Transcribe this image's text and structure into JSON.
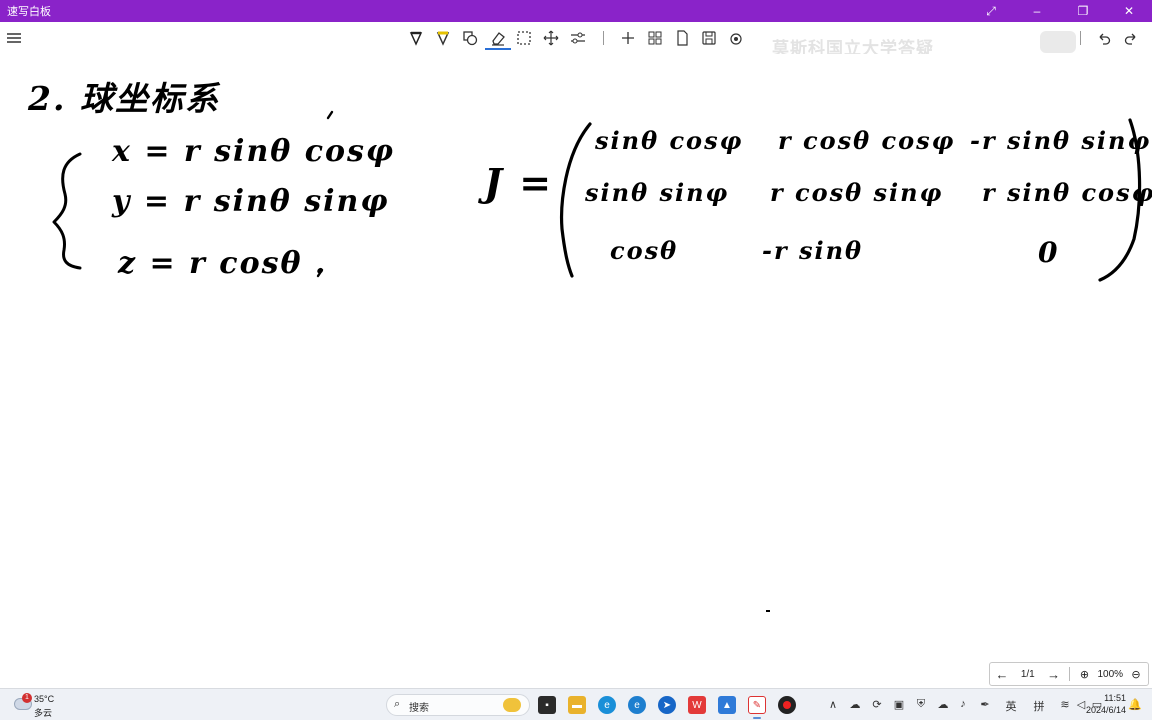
{
  "window": {
    "title": "速写白板"
  },
  "watermark": {
    "text": "莫斯科国立大学答疑"
  },
  "toolbar": {
    "accent_color": "#2a6fd6",
    "titlebar_color": "#8a23c9"
  },
  "ink": {
    "heading": "2. 球坐标系",
    "equations": [
      "x = r sinθ cosφ",
      "y = r sinθ sinφ",
      "z = r cosθ ."
    ],
    "jacobian_label": "J =",
    "matrix": [
      [
        "sinθ cosφ",
        "r cosθ cosφ",
        "-r sinθ sinφ"
      ],
      [
        "sinθ sinφ",
        "r cosθ sinφ",
        "r sinθ cosφ"
      ],
      [
        "cosθ",
        "-r sinθ",
        "0"
      ]
    ]
  },
  "pagenav": {
    "prev": "←",
    "page": "1/1",
    "next": "→",
    "zoom": "100%"
  },
  "taskbar": {
    "weather_temp": "35°C",
    "weather_cond": "多云",
    "weather_badge": "1",
    "search_placeholder": "搜索",
    "ime_lang": "英",
    "ime_mode": "拼",
    "time": "11:51",
    "date": "2024/6/14"
  }
}
